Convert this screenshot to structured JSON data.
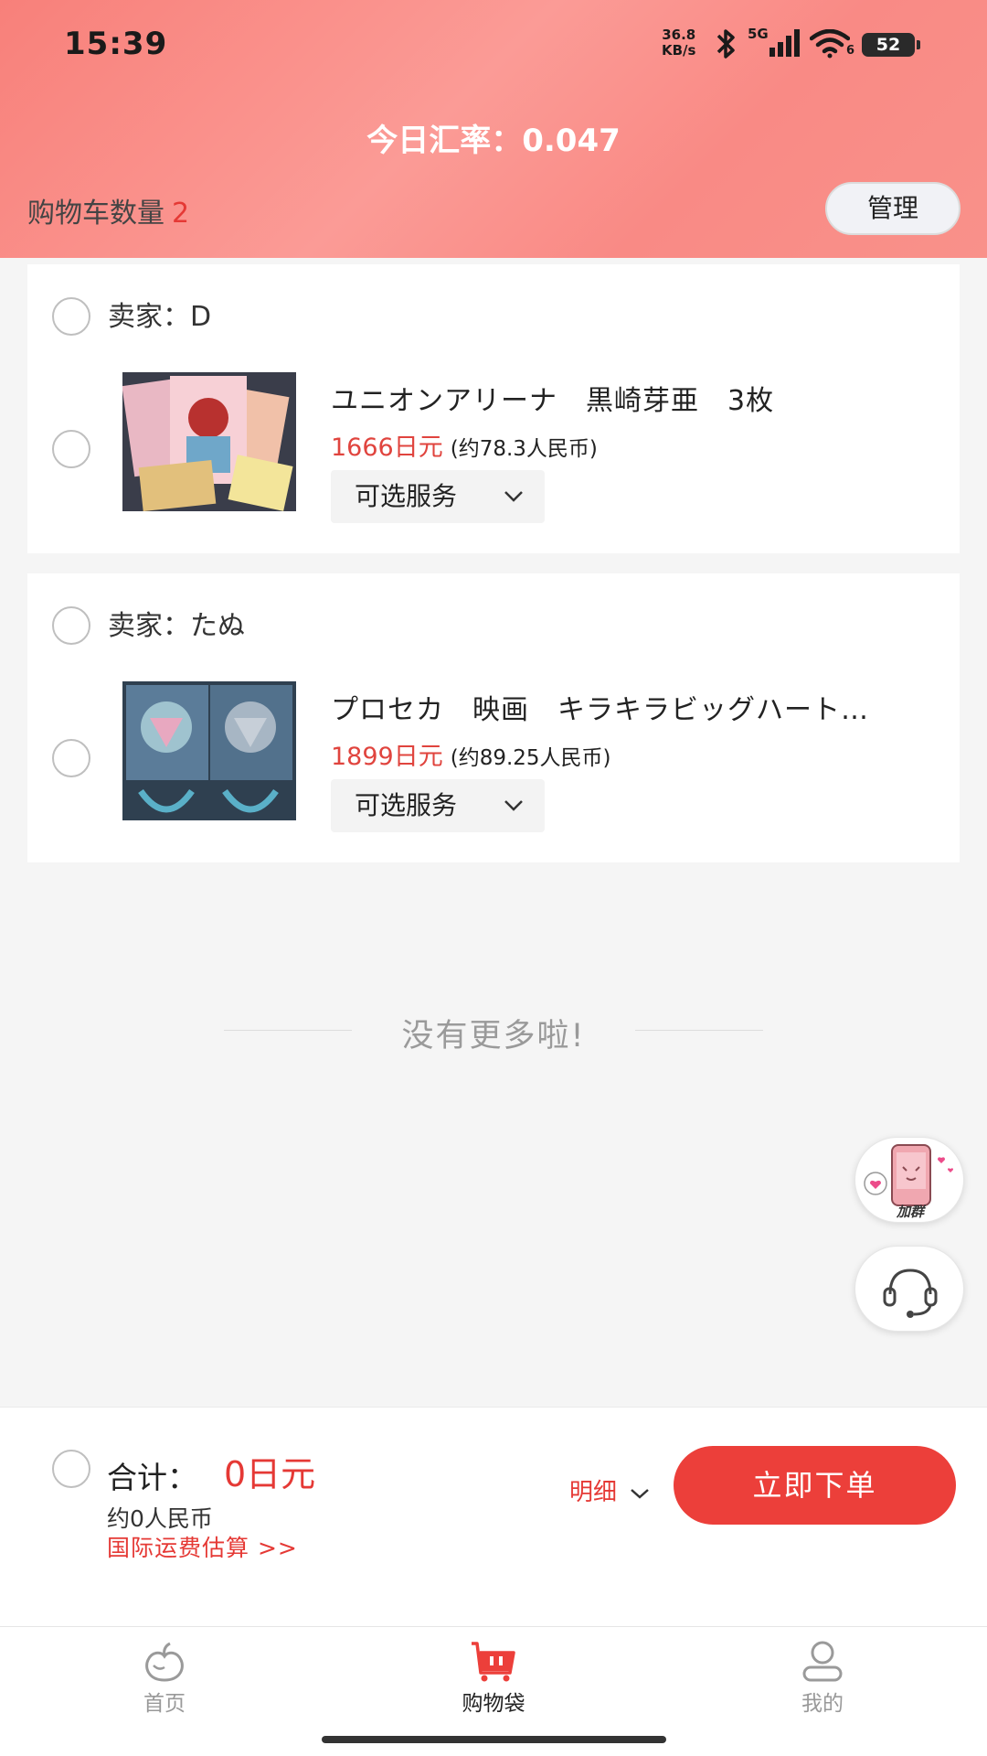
{
  "status_bar": {
    "time": "15:39",
    "net_speed_value": "36.8",
    "net_speed_unit": "KB/s",
    "signal_label": "5G",
    "wifi_sub": "6",
    "battery": "52"
  },
  "header": {
    "exchange_rate": "今日汇率：0.047",
    "cart_count_label": "购物车数量",
    "cart_count": "2",
    "manage_label": "管理"
  },
  "sellers": [
    {
      "seller_label": "卖家：D",
      "item": {
        "title": "ユニオンアリーナ　黒崎芽亜　3枚",
        "price_jpy": "1666日元",
        "price_cny": "(约78.3人民币)",
        "service_label": "可选服务"
      }
    },
    {
      "seller_label": "卖家：たぬ",
      "item": {
        "title": "プロセカ　映画　キラキラビッグハート…",
        "price_jpy": "1899日元",
        "price_cny": "(约89.25人民币)",
        "service_label": "可选服务"
      }
    }
  ],
  "list_end_text": "没有更多啦!",
  "floating": {
    "group_badge": "加群",
    "support_icon": "headset-icon"
  },
  "checkout": {
    "total_label": "合计：",
    "total_amount": "0日元",
    "cny_total": "约0人民币",
    "shipping_link": "国际运费估算 >>",
    "detail_label": "明细",
    "order_button": "立即下单"
  },
  "tabs": [
    {
      "label": "首页",
      "icon": "peach-icon",
      "active": false
    },
    {
      "label": "购物袋",
      "icon": "shopping-bag-icon",
      "active": true
    },
    {
      "label": "我的",
      "icon": "user-icon",
      "active": false
    }
  ],
  "colors": {
    "accent": "#ec3f3a",
    "header_gradient": "#f98a85",
    "muted": "#999999"
  }
}
